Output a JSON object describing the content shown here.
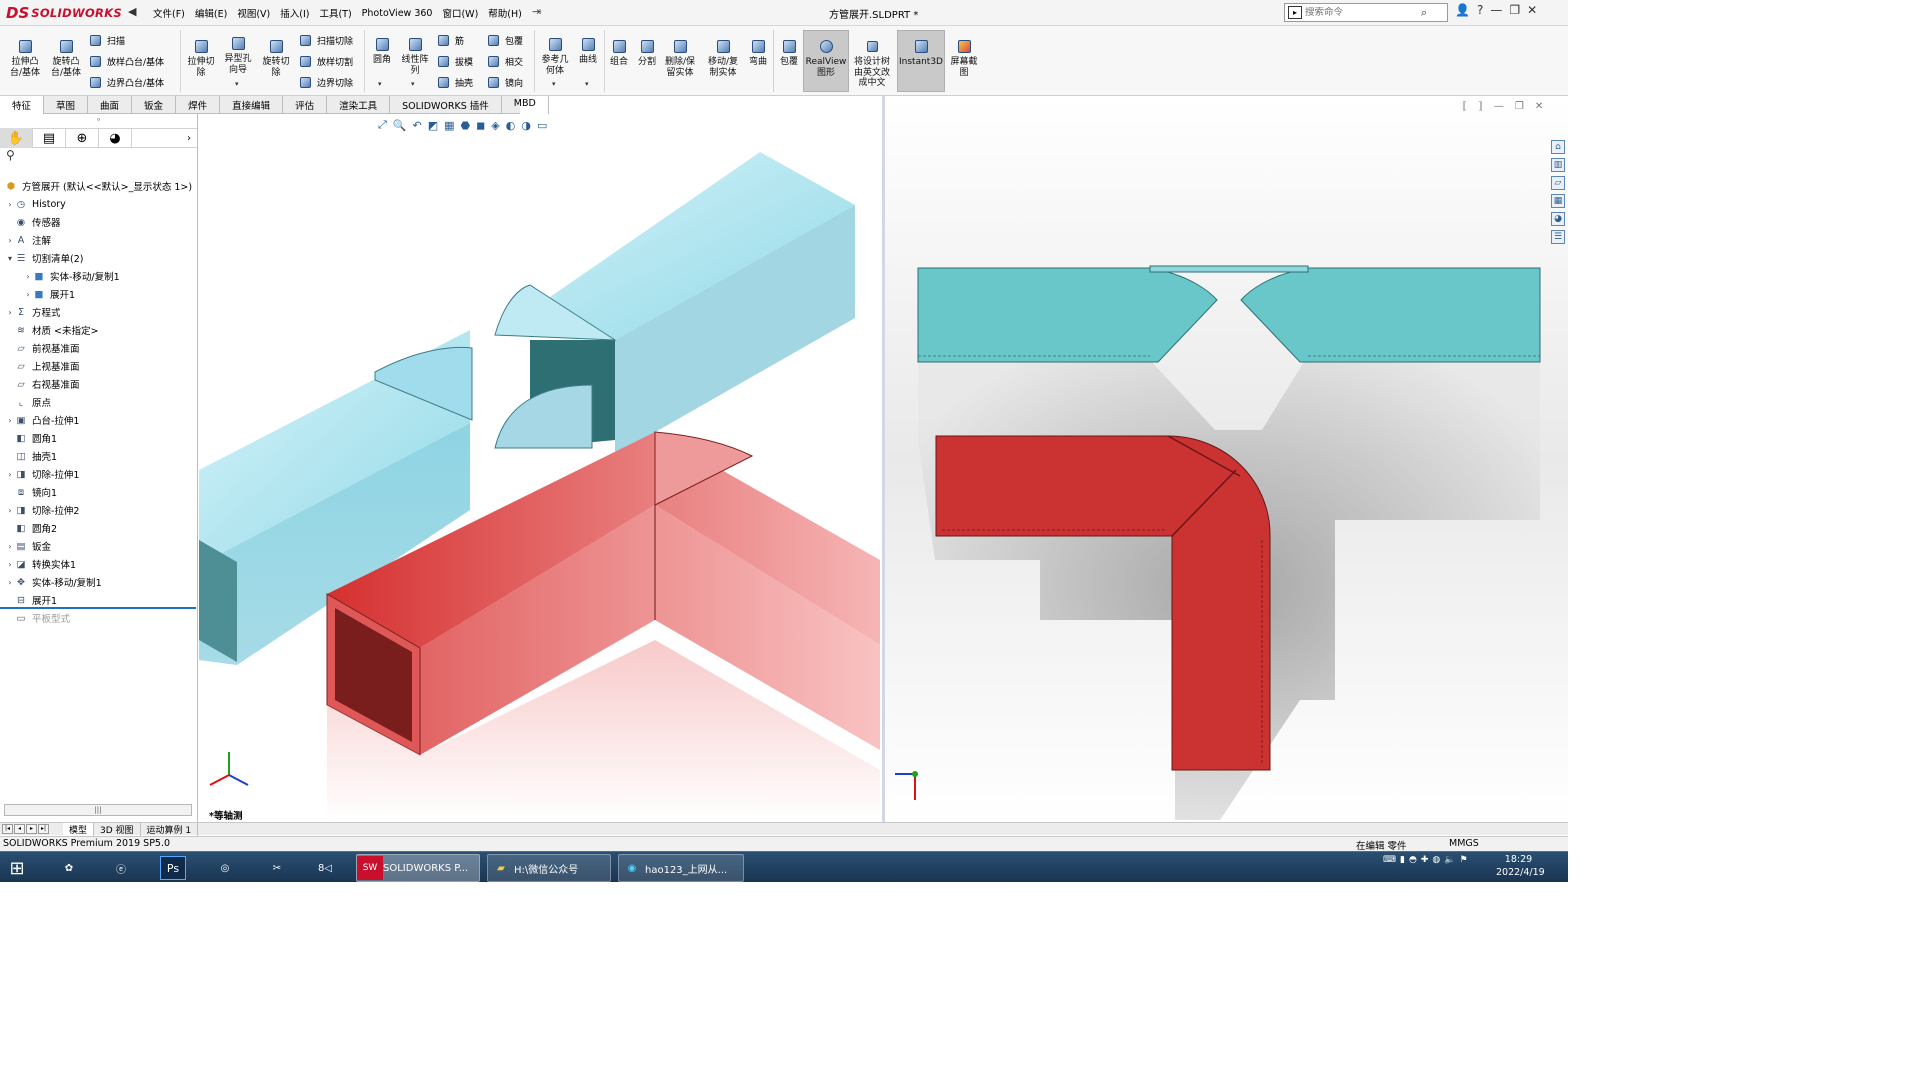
{
  "app": {
    "logo_ds": "DS",
    "logo_name": "SOLIDWORKS",
    "document_title": "方管展开.SLDPRT *"
  },
  "menu": [
    "文件(F)",
    "编辑(E)",
    "视图(V)",
    "插入(I)",
    "工具(T)",
    "PhotoView 360",
    "窗口(W)",
    "帮助(H)"
  ],
  "search": {
    "placeholder": "搜索命令"
  },
  "toolbar": {
    "extrude_boss": "拉伸凸\n台/基体",
    "revolve_boss": "旋转凸\n台/基体",
    "sweep": "扫描",
    "loft_boss": "放样凸台/基体",
    "boundary_boss": "边界凸台/基体",
    "extrude_cut": "拉伸切\n除",
    "hole_wizard": "异型孔\n向导",
    "revolve_cut": "旋转切\n除",
    "sweep_cut": "扫描切除",
    "loft_cut": "放样切割",
    "boundary_cut": "边界切除",
    "fillet": "圆角",
    "linear_pattern": "线性阵\n列",
    "rib": "筋",
    "draft": "拔模",
    "shell": "抽壳",
    "wrap": "包覆",
    "intersect": "相交",
    "mirror": "镜向",
    "ref_geometry": "参考几\n何体",
    "curves": "曲线",
    "combine": "组合",
    "split": "分割",
    "delete_keep": "删除/保\n留实体",
    "move_copy": "移动/复\n制实体",
    "flex": "弯曲",
    "wrap2": "包覆",
    "realview": "RealView\n图形",
    "translate_tree": "将设计树\n由英文改\n成中文",
    "instant3d": "Instant3D",
    "screen_capture": "屏幕截\n图"
  },
  "tabs": [
    "特征",
    "草图",
    "曲面",
    "钣金",
    "焊件",
    "直接编辑",
    "评估",
    "渲染工具",
    "SOLIDWORKS 插件",
    "MBD"
  ],
  "feature_tree": {
    "root": "方管展开  (默认<<默认>_显示状态 1>)",
    "items": [
      {
        "label": "History",
        "icon": "history-icon",
        "expand": true
      },
      {
        "label": "传感器",
        "icon": "sensor-icon",
        "expand": false
      },
      {
        "label": "注解",
        "icon": "annotation-icon",
        "expand": true
      },
      {
        "label": "切割清单(2)",
        "icon": "cut-list-icon",
        "expand": true,
        "open": true
      },
      {
        "label": "实体-移动/复制1",
        "icon": "body-icon",
        "expand": true,
        "indent": true
      },
      {
        "label": "展开1",
        "icon": "body-icon",
        "expand": true,
        "indent": true
      },
      {
        "label": "方程式",
        "icon": "equation-icon",
        "expand": true
      },
      {
        "label": "材质 <未指定>",
        "icon": "material-icon",
        "expand": false
      },
      {
        "label": "前视基准面",
        "icon": "plane-icon",
        "expand": false
      },
      {
        "label": "上视基准面",
        "icon": "plane-icon",
        "expand": false
      },
      {
        "label": "右视基准面",
        "icon": "plane-icon",
        "expand": false
      },
      {
        "label": "原点",
        "icon": "origin-icon",
        "expand": false
      },
      {
        "label": "凸台-拉伸1",
        "icon": "extrude-icon",
        "expand": true
      },
      {
        "label": "圆角1",
        "icon": "fillet-icon",
        "expand": false
      },
      {
        "label": "抽壳1",
        "icon": "shell-icon",
        "expand": false
      },
      {
        "label": "切除-拉伸1",
        "icon": "cut-icon",
        "expand": true
      },
      {
        "label": "镜向1",
        "icon": "mirror-icon",
        "expand": false
      },
      {
        "label": "切除-拉伸2",
        "icon": "cut-icon",
        "expand": true
      },
      {
        "label": "圆角2",
        "icon": "fillet-icon",
        "expand": false
      },
      {
        "label": "钣金",
        "icon": "sheetmetal-icon",
        "expand": true
      },
      {
        "label": "转换实体1",
        "icon": "convert-icon",
        "expand": true
      },
      {
        "label": "实体-移动/复制1",
        "icon": "move-icon",
        "expand": true
      },
      {
        "label": "展开1",
        "icon": "unfold-icon",
        "expand": false
      },
      {
        "label": "平板型式",
        "icon": "flat-pattern-icon",
        "expand": false,
        "grey": true
      }
    ]
  },
  "viewport_left": {
    "view_name": "*等轴测"
  },
  "bottom_tabs": [
    "模型",
    "3D 视图",
    "运动算例 1"
  ],
  "status": {
    "left": "SOLIDWORKS Premium 2019 SP5.0",
    "mode": "在编辑 零件",
    "units": "MMGS"
  },
  "taskbar": {
    "apps": [
      {
        "label": "SOLIDWORKS P...",
        "icon": "solidworks-icon"
      },
      {
        "label": "H:\\微信公众号",
        "icon": "folder-icon"
      },
      {
        "label": "hao123_上网从...",
        "icon": "browser-icon"
      }
    ],
    "time": "18:29",
    "date": "2022/4/19"
  },
  "colors": {
    "cyan_body": "#9bd6e2",
    "red_body": "#d63a3a",
    "brand": "#c8102e"
  }
}
